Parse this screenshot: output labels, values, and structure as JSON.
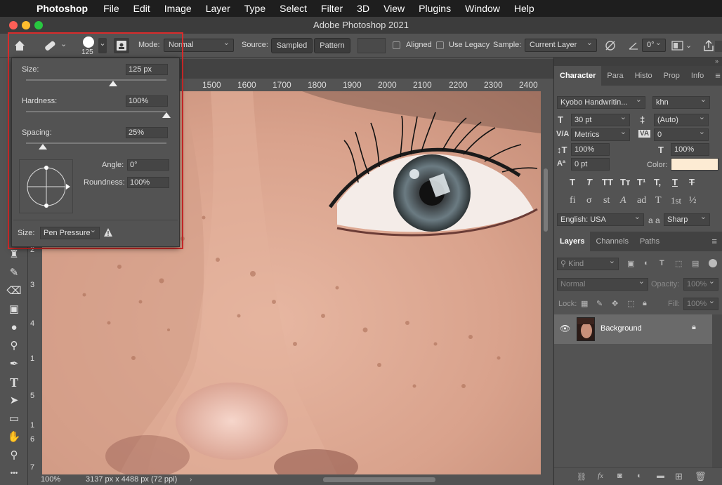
{
  "menubar": {
    "app": "Photoshop",
    "items": [
      "File",
      "Edit",
      "Image",
      "Layer",
      "Type",
      "Select",
      "Filter",
      "3D",
      "View",
      "Plugins",
      "Window",
      "Help"
    ]
  },
  "window_title": "Adobe Photoshop 2021",
  "options": {
    "brush_size": "125",
    "mode_label": "Mode:",
    "mode_value": "Normal",
    "source_label": "Source:",
    "source_sampled": "Sampled",
    "source_pattern": "Pattern",
    "aligned_label": "Aligned",
    "use_legacy_label": "Use Legacy",
    "sample_label": "Sample:",
    "sample_value": "Current Layer",
    "angle_value": "0°"
  },
  "brush_popup": {
    "size_label": "Size:",
    "size_value": "125 px",
    "hardness_label": "Hardness:",
    "hardness_value": "100%",
    "spacing_label": "Spacing:",
    "spacing_value": "25%",
    "angle_label": "Angle:",
    "angle_value": "0°",
    "roundness_label": "Roundness:",
    "roundness_value": "100%",
    "size_control_label": "Size:",
    "size_control_value": "Pen Pressure",
    "size_fraction": 0.62,
    "hardness_fraction": 1.0,
    "spacing_fraction": 0.12
  },
  "ruler_top": [
    "1500",
    "1600",
    "1700",
    "1800",
    "1900",
    "2000",
    "2100",
    "2200",
    "2300",
    "2400"
  ],
  "ruler_left": [
    "2",
    "3",
    "4",
    "1",
    "5",
    "1",
    "6",
    "7"
  ],
  "status": {
    "zoom": "100%",
    "dimensions": "3137 px x 4488 px (72 ppi)"
  },
  "character_panel": {
    "tabs": [
      "Character",
      "Para",
      "Histo",
      "Prop",
      "Info"
    ],
    "font_family": "Kyobo Handwritin...",
    "font_style": "khn",
    "font_size": "30 pt",
    "leading": "(Auto)",
    "kerning": "Metrics",
    "tracking": "0",
    "vertical_scale": "100%",
    "horizontal_scale": "100%",
    "baseline_shift": "0 pt",
    "color_label": "Color:",
    "color_value": "#fdebd3",
    "type_buttons": [
      "T",
      "T",
      "TT",
      "Tт",
      "T¹",
      "T,",
      "T",
      "T"
    ],
    "ot_buttons": [
      "fi",
      "σ",
      "st",
      "A",
      "ad",
      "T",
      "1st",
      "½"
    ],
    "language": "English: USA",
    "aa_label": "a a",
    "antialias": "Sharp"
  },
  "layers_panel": {
    "tabs": [
      "Layers",
      "Channels",
      "Paths"
    ],
    "filter_kind": "Kind",
    "blend_mode": "Normal",
    "opacity_label": "Opacity:",
    "opacity_value": "100%",
    "lock_label": "Lock:",
    "fill_label": "Fill:",
    "fill_value": "100%",
    "layer_name": "Background"
  },
  "colors": {
    "accent_red": "#d92b2b",
    "panel_bg": "#535353",
    "dark_bg": "#424242"
  }
}
